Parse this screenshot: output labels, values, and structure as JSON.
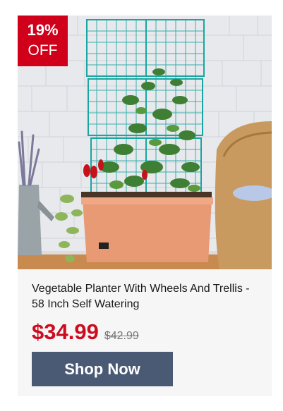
{
  "badge": {
    "percent": "19%",
    "off_label": "OFF"
  },
  "product": {
    "image_alt": "Vegetable planter with green trellis in front of shingle wall",
    "title": "Vegetable Planter With Wheels And Trellis - 58 Inch Self Watering",
    "price": "$34.99",
    "original_price": "$42.99"
  },
  "cta": {
    "label": "Shop Now"
  },
  "colors": {
    "badge": "#d0001b",
    "price": "#cc0c1f",
    "button": "#4a5a75",
    "trellis": "#1aa6a0",
    "planter": "#e89a74"
  }
}
